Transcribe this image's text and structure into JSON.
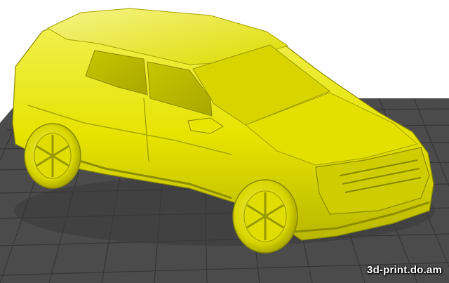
{
  "viewer": {
    "watermark": "3d-print.do.am",
    "colors": {
      "background": "#ffffff",
      "bed": "#4a4a4a",
      "bed_grid": "#3a3a3a",
      "model": "#e9e600",
      "model_shadow": "#8c8a00",
      "model_highlight": "#f7f570"
    }
  }
}
